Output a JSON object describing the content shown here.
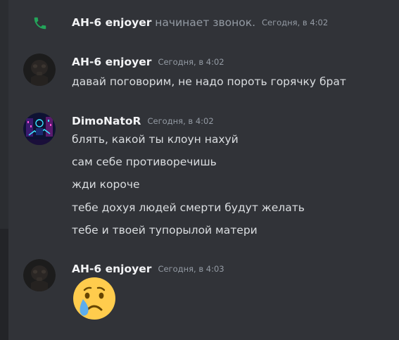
{
  "messages": {
    "system": {
      "icon": "phone-icon",
      "username": "AH-6 enjoyer",
      "action": "начинает звонок.",
      "timestamp": "Сегодня, в 4:02"
    },
    "group1": {
      "username": "AH-6 enjoyer",
      "timestamp": "Сегодня, в 4:02",
      "lines": [
        "давай поговорим, не надо пороть горячку брат"
      ]
    },
    "group2": {
      "username": "DimoNatoR",
      "timestamp": "Сегодня, в 4:02",
      "lines": [
        "блять, какой ты клоун нахуй",
        "сам себе противоречишь",
        "жди короче",
        "тебе дохуя людей смерти будут желать",
        "тебе и твоей тупорылой матери"
      ]
    },
    "group3": {
      "username": "AH-6 enjoyer",
      "timestamp": "Сегодня, в 4:03",
      "emoji": "crying-face-emoji"
    }
  },
  "colors": {
    "background": "#313338",
    "username": "#f2f3f5",
    "message_text": "#dbdee1",
    "muted_text": "#949ba4",
    "call_icon": "#23a55a"
  }
}
